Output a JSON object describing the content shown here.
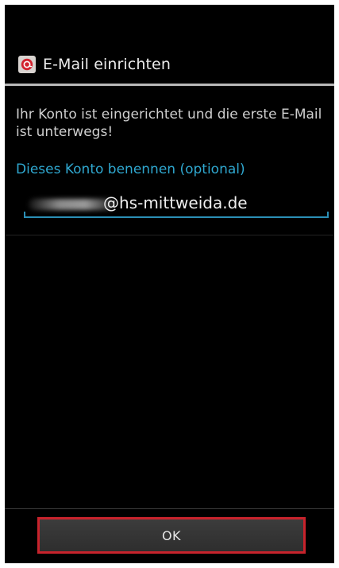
{
  "dialog": {
    "title": "E-Mail einrichten",
    "app_icon": "email-app-icon",
    "message": "Ihr Konto ist eingerichtet und die erste E-Mail ist unterwegs!",
    "name_label": "Dieses Konto benennen (optional)",
    "name_field_value": "@hs-mittweida.de",
    "ok_label": "OK"
  },
  "colors": {
    "accent": "#2fa7cf",
    "highlight_border": "#c8232c",
    "background": "#000000"
  }
}
